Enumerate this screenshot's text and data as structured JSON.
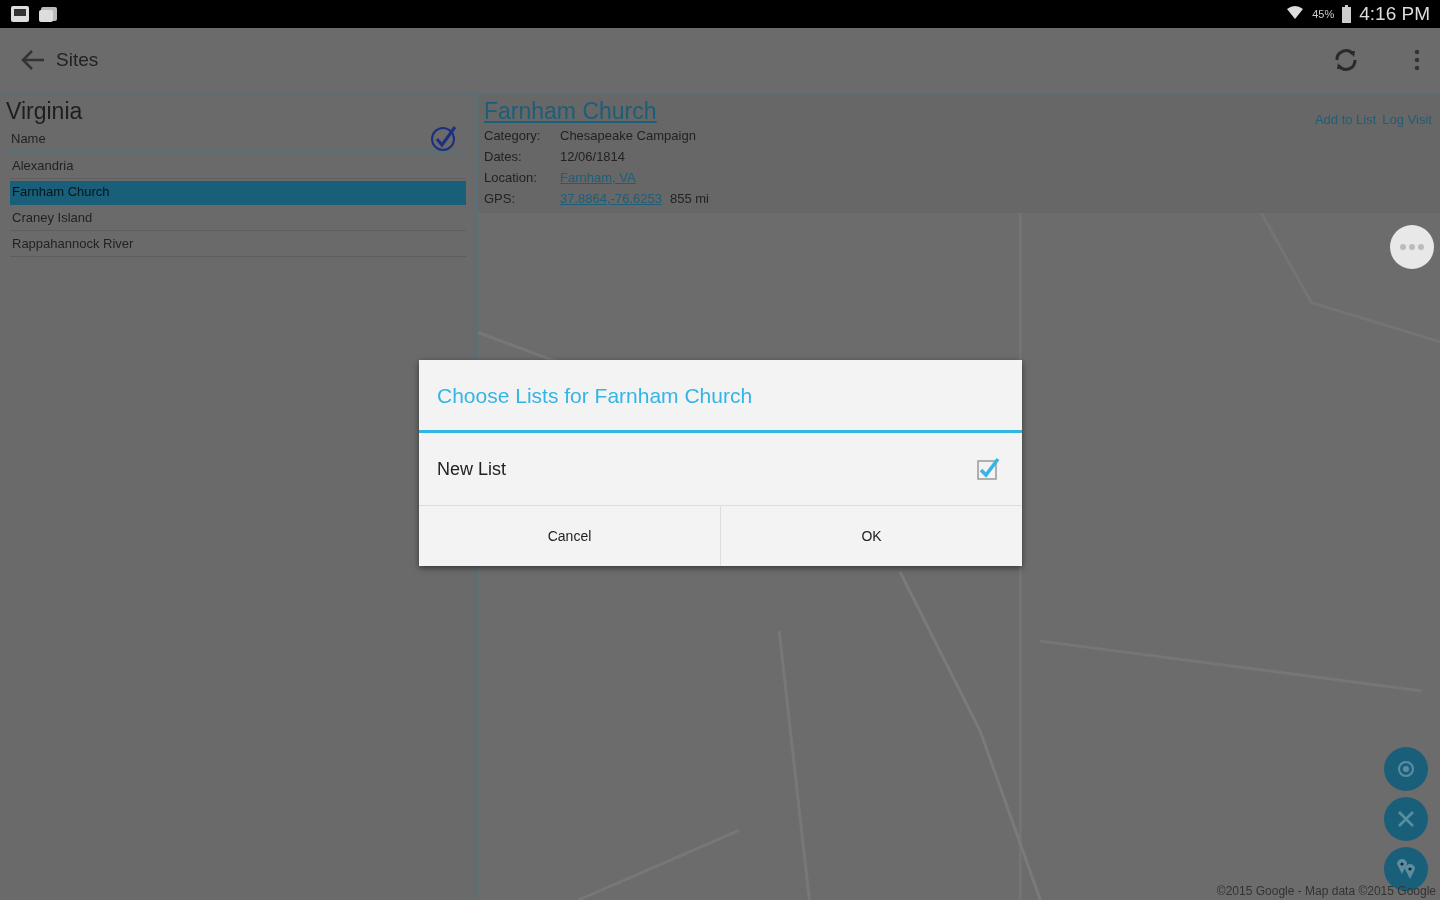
{
  "status_bar": {
    "battery": "45%",
    "time": "4:16 PM"
  },
  "app_bar": {
    "title": "Sites"
  },
  "list": {
    "heading": "Virginia",
    "column": "Name",
    "items": [
      {
        "label": "Alexandria",
        "selected": false
      },
      {
        "label": "Farnham Church",
        "selected": true
      },
      {
        "label": "Craney Island",
        "selected": false
      },
      {
        "label": "Rappahannock River",
        "selected": false
      }
    ]
  },
  "detail": {
    "title": "Farnham Church",
    "actions": [
      "Add to List",
      "Log Visit"
    ],
    "fields": [
      {
        "label": "Category:",
        "value": "Chesapeake Campaign",
        "kind": "text"
      },
      {
        "label": "Dates:",
        "value": "12/06/1814",
        "kind": "text"
      },
      {
        "label": "Location:",
        "value": "Farnham, VA",
        "kind": "link"
      },
      {
        "label": "GPS:",
        "value": "37.8864,-76.6253",
        "extra": "855 mi",
        "kind": "link"
      }
    ]
  },
  "map": {
    "kind": "picture",
    "attribution": "©2015 Google - Map data ©2015 Google"
  },
  "dialog": {
    "title": "Choose Lists for Farnham Church",
    "options": [
      {
        "label": "New List",
        "checked": true
      }
    ],
    "buttons": [
      "Cancel",
      "OK"
    ]
  }
}
